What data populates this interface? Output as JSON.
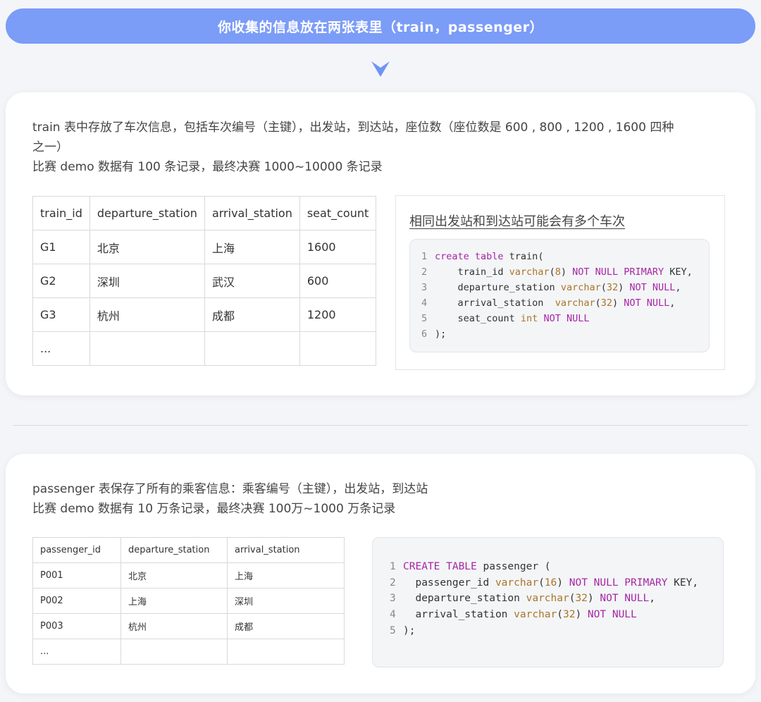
{
  "banner": {
    "text": "你收集的信息放在两张表里（train，passenger）"
  },
  "colors": {
    "banner": "#7b9cf7",
    "keyword": "#a626a4",
    "type": "#a8762a"
  },
  "train_section": {
    "desc_line1": "train 表中存放了车次信息，包括车次编号（主键），出发站，到达站，座位数（座位数是 600 , 800 , 1200 , 1600 四种",
    "desc_line2": "之一）",
    "desc_line3": "比赛 demo 数据有 100 条记录，最终决赛 1000~10000 条记录",
    "table": {
      "headers": [
        "train_id",
        "departure_station",
        "arrival_station",
        "seat_count"
      ],
      "rows": [
        [
          "G1",
          "北京",
          "上海",
          "1600"
        ],
        [
          "G2",
          "深圳",
          "武汉",
          "600"
        ],
        [
          "G3",
          "杭州",
          "成都",
          "1200"
        ],
        [
          "...",
          "",
          "",
          ""
        ]
      ]
    },
    "note": "相同出发站和到达站可能会有多个车次",
    "code": [
      {
        "n": "1",
        "parts": [
          [
            "kw",
            "create table"
          ],
          [
            "",
            " train("
          ]
        ]
      },
      {
        "n": "2",
        "parts": [
          [
            "",
            "    train_id "
          ],
          [
            "ty",
            "varchar"
          ],
          [
            "",
            "("
          ],
          [
            "num",
            "8"
          ],
          [
            "",
            ") "
          ],
          [
            "kw",
            "NOT NULL PRIMARY"
          ],
          [
            "",
            " KEY,"
          ]
        ]
      },
      {
        "n": "3",
        "parts": [
          [
            "",
            "    departure_station "
          ],
          [
            "ty",
            "varchar"
          ],
          [
            "",
            "("
          ],
          [
            "num",
            "32"
          ],
          [
            "",
            ") "
          ],
          [
            "kw",
            "NOT NULL"
          ],
          [
            "",
            ","
          ]
        ]
      },
      {
        "n": "4",
        "parts": [
          [
            "",
            "    arrival_station  "
          ],
          [
            "ty",
            "varchar"
          ],
          [
            "",
            "("
          ],
          [
            "num",
            "32"
          ],
          [
            "",
            ") "
          ],
          [
            "kw",
            "NOT NULL"
          ],
          [
            "",
            ","
          ]
        ]
      },
      {
        "n": "5",
        "parts": [
          [
            "",
            "    seat_count "
          ],
          [
            "ty",
            "int"
          ],
          [
            "",
            " "
          ],
          [
            "kw",
            "NOT NULL"
          ]
        ]
      },
      {
        "n": "6",
        "parts": [
          [
            "",
            ");"
          ]
        ]
      }
    ]
  },
  "passenger_section": {
    "desc_line1": "passenger 表保存了所有的乘客信息：乘客编号（主键），出发站，到达站",
    "desc_line2": "比赛 demo 数据有 10 万条记录，最终决赛 100万~1000 万条记录",
    "table": {
      "headers": [
        "passenger_id",
        "departure_station",
        "arrival_station"
      ],
      "rows": [
        [
          "P001",
          "北京",
          "上海"
        ],
        [
          "P002",
          "上海",
          "深圳"
        ],
        [
          "P003",
          "杭州",
          "成都"
        ],
        [
          "...",
          "",
          ""
        ]
      ]
    },
    "code": [
      {
        "n": "1",
        "parts": [
          [
            "kw",
            "CREATE TABLE"
          ],
          [
            "",
            " passenger ("
          ]
        ]
      },
      {
        "n": "2",
        "parts": [
          [
            "",
            "  passenger_id "
          ],
          [
            "ty",
            "varchar"
          ],
          [
            "",
            "("
          ],
          [
            "num",
            "16"
          ],
          [
            "",
            ") "
          ],
          [
            "kw",
            "NOT NULL PRIMARY"
          ],
          [
            "",
            " KEY,"
          ]
        ]
      },
      {
        "n": "3",
        "parts": [
          [
            "",
            "  departure_station "
          ],
          [
            "ty",
            "varchar"
          ],
          [
            "",
            "("
          ],
          [
            "num",
            "32"
          ],
          [
            "",
            ") "
          ],
          [
            "kw",
            "NOT NULL"
          ],
          [
            "",
            ","
          ]
        ]
      },
      {
        "n": "4",
        "parts": [
          [
            "",
            "  arrival_station "
          ],
          [
            "ty",
            "varchar"
          ],
          [
            "",
            "("
          ],
          [
            "num",
            "32"
          ],
          [
            "",
            ") "
          ],
          [
            "kw",
            "NOT NULL"
          ]
        ]
      },
      {
        "n": "5",
        "parts": [
          [
            "",
            ");"
          ]
        ]
      }
    ]
  }
}
